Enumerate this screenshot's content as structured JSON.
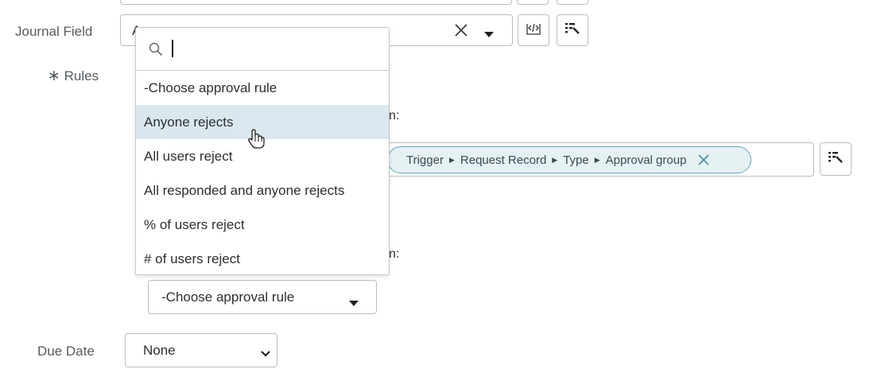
{
  "journal_field": {
    "label": "Journal Field",
    "value_partial": "A"
  },
  "rules": {
    "required_mark": "∗",
    "label": "Rules"
  },
  "when_suffix_1": "n:",
  "when_suffix_2": "n:",
  "group_pill": {
    "segments": [
      "Trigger",
      "Request Record",
      "Type",
      "Approval group"
    ]
  },
  "dropdown": {
    "search_placeholder": "",
    "items": [
      "-Choose approval rule",
      "Anyone rejects",
      "All users reject",
      "All responded and anyone rejects",
      "% of users reject",
      "# of users reject"
    ],
    "highlighted_index": 1
  },
  "reject_rule_select": {
    "value": "-Choose approval rule"
  },
  "due_date": {
    "label": "Due Date",
    "value": "None"
  },
  "colors": {
    "highlight": "#d8e8ee",
    "pill_border": "#5ea8b5",
    "pill_bg": "#e6f1f4"
  }
}
